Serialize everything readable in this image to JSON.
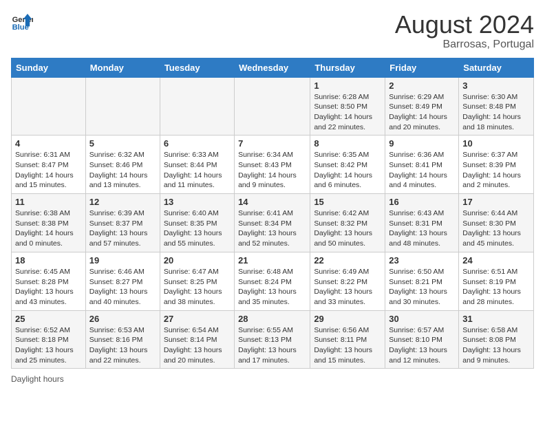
{
  "header": {
    "logo_line1": "General",
    "logo_line2": "Blue",
    "title": "August 2024",
    "subtitle": "Barrosas, Portugal"
  },
  "days_of_week": [
    "Sunday",
    "Monday",
    "Tuesday",
    "Wednesday",
    "Thursday",
    "Friday",
    "Saturday"
  ],
  "weeks": [
    [
      {
        "day": "",
        "info": ""
      },
      {
        "day": "",
        "info": ""
      },
      {
        "day": "",
        "info": ""
      },
      {
        "day": "",
        "info": ""
      },
      {
        "day": "1",
        "info": "Sunrise: 6:28 AM\nSunset: 8:50 PM\nDaylight: 14 hours and 22 minutes."
      },
      {
        "day": "2",
        "info": "Sunrise: 6:29 AM\nSunset: 8:49 PM\nDaylight: 14 hours and 20 minutes."
      },
      {
        "day": "3",
        "info": "Sunrise: 6:30 AM\nSunset: 8:48 PM\nDaylight: 14 hours and 18 minutes."
      }
    ],
    [
      {
        "day": "4",
        "info": "Sunrise: 6:31 AM\nSunset: 8:47 PM\nDaylight: 14 hours and 15 minutes."
      },
      {
        "day": "5",
        "info": "Sunrise: 6:32 AM\nSunset: 8:46 PM\nDaylight: 14 hours and 13 minutes."
      },
      {
        "day": "6",
        "info": "Sunrise: 6:33 AM\nSunset: 8:44 PM\nDaylight: 14 hours and 11 minutes."
      },
      {
        "day": "7",
        "info": "Sunrise: 6:34 AM\nSunset: 8:43 PM\nDaylight: 14 hours and 9 minutes."
      },
      {
        "day": "8",
        "info": "Sunrise: 6:35 AM\nSunset: 8:42 PM\nDaylight: 14 hours and 6 minutes."
      },
      {
        "day": "9",
        "info": "Sunrise: 6:36 AM\nSunset: 8:41 PM\nDaylight: 14 hours and 4 minutes."
      },
      {
        "day": "10",
        "info": "Sunrise: 6:37 AM\nSunset: 8:39 PM\nDaylight: 14 hours and 2 minutes."
      }
    ],
    [
      {
        "day": "11",
        "info": "Sunrise: 6:38 AM\nSunset: 8:38 PM\nDaylight: 14 hours and 0 minutes."
      },
      {
        "day": "12",
        "info": "Sunrise: 6:39 AM\nSunset: 8:37 PM\nDaylight: 13 hours and 57 minutes."
      },
      {
        "day": "13",
        "info": "Sunrise: 6:40 AM\nSunset: 8:35 PM\nDaylight: 13 hours and 55 minutes."
      },
      {
        "day": "14",
        "info": "Sunrise: 6:41 AM\nSunset: 8:34 PM\nDaylight: 13 hours and 52 minutes."
      },
      {
        "day": "15",
        "info": "Sunrise: 6:42 AM\nSunset: 8:32 PM\nDaylight: 13 hours and 50 minutes."
      },
      {
        "day": "16",
        "info": "Sunrise: 6:43 AM\nSunset: 8:31 PM\nDaylight: 13 hours and 48 minutes."
      },
      {
        "day": "17",
        "info": "Sunrise: 6:44 AM\nSunset: 8:30 PM\nDaylight: 13 hours and 45 minutes."
      }
    ],
    [
      {
        "day": "18",
        "info": "Sunrise: 6:45 AM\nSunset: 8:28 PM\nDaylight: 13 hours and 43 minutes."
      },
      {
        "day": "19",
        "info": "Sunrise: 6:46 AM\nSunset: 8:27 PM\nDaylight: 13 hours and 40 minutes."
      },
      {
        "day": "20",
        "info": "Sunrise: 6:47 AM\nSunset: 8:25 PM\nDaylight: 13 hours and 38 minutes."
      },
      {
        "day": "21",
        "info": "Sunrise: 6:48 AM\nSunset: 8:24 PM\nDaylight: 13 hours and 35 minutes."
      },
      {
        "day": "22",
        "info": "Sunrise: 6:49 AM\nSunset: 8:22 PM\nDaylight: 13 hours and 33 minutes."
      },
      {
        "day": "23",
        "info": "Sunrise: 6:50 AM\nSunset: 8:21 PM\nDaylight: 13 hours and 30 minutes."
      },
      {
        "day": "24",
        "info": "Sunrise: 6:51 AM\nSunset: 8:19 PM\nDaylight: 13 hours and 28 minutes."
      }
    ],
    [
      {
        "day": "25",
        "info": "Sunrise: 6:52 AM\nSunset: 8:18 PM\nDaylight: 13 hours and 25 minutes."
      },
      {
        "day": "26",
        "info": "Sunrise: 6:53 AM\nSunset: 8:16 PM\nDaylight: 13 hours and 22 minutes."
      },
      {
        "day": "27",
        "info": "Sunrise: 6:54 AM\nSunset: 8:14 PM\nDaylight: 13 hours and 20 minutes."
      },
      {
        "day": "28",
        "info": "Sunrise: 6:55 AM\nSunset: 8:13 PM\nDaylight: 13 hours and 17 minutes."
      },
      {
        "day": "29",
        "info": "Sunrise: 6:56 AM\nSunset: 8:11 PM\nDaylight: 13 hours and 15 minutes."
      },
      {
        "day": "30",
        "info": "Sunrise: 6:57 AM\nSunset: 8:10 PM\nDaylight: 13 hours and 12 minutes."
      },
      {
        "day": "31",
        "info": "Sunrise: 6:58 AM\nSunset: 8:08 PM\nDaylight: 13 hours and 9 minutes."
      }
    ]
  ],
  "footer": {
    "daylight_label": "Daylight hours"
  }
}
